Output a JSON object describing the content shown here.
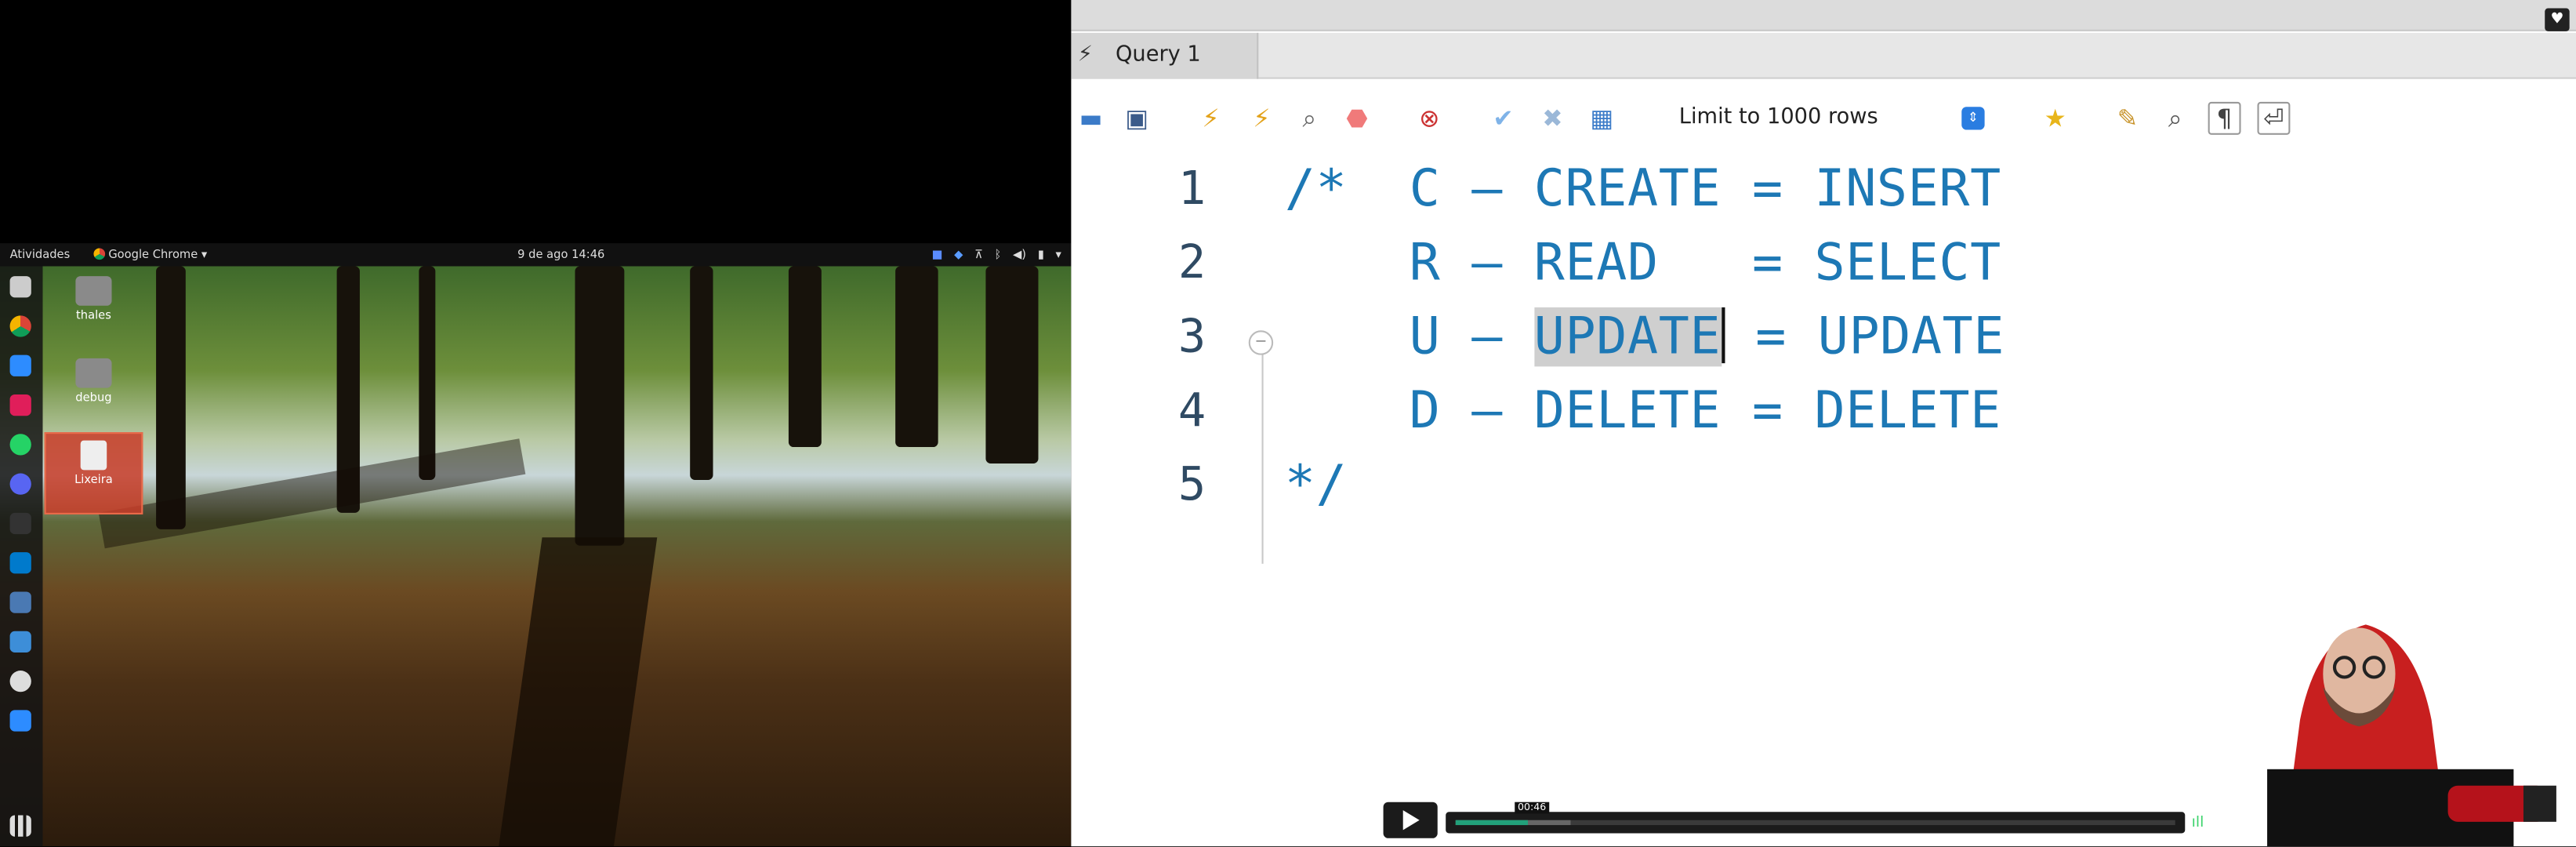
{
  "desktop": {
    "topbar": {
      "activities": "Atividades",
      "app_menu": "Google Chrome ▾",
      "clock": "9 de ago  14:46"
    },
    "items": [
      {
        "label": "thales"
      },
      {
        "label": "debug"
      },
      {
        "label": "Lixeira"
      }
    ],
    "dock_icons": [
      "files-icon",
      "chrome-icon",
      "zoom-icon",
      "slack-icon",
      "whatsapp-icon",
      "discord-icon",
      "terminal-icon",
      "vscode-icon",
      "workbench-icon",
      "screenshot-icon",
      "obs-icon",
      "zoom-meeting-icon",
      "app-grid-icon"
    ]
  },
  "workbench": {
    "tab": {
      "label": "Query 1"
    },
    "toolbar": {
      "limit": "Limit to 1000 rows",
      "icons": [
        "open-file-icon",
        "save-icon",
        "execute-icon",
        "execute-current-icon",
        "explain-icon",
        "stop-icon",
        "toggle-error-icon",
        "commit-icon",
        "rollback-icon",
        "autocommit-icon",
        "add-snippet-icon",
        "beautify-icon",
        "find-icon",
        "invisible-chars-icon",
        "wrap-icon"
      ]
    },
    "editor": {
      "lines": [
        {
          "num": "1",
          "pre": "/*  C – CREATE = INSERT",
          "sel": "",
          "post": ""
        },
        {
          "num": "2",
          "pre": "    R – READ   = SELECT",
          "sel": "",
          "post": ""
        },
        {
          "num": "3",
          "pre": "    U – ",
          "sel": "UPDATE",
          "post": " = UPDATE"
        },
        {
          "num": "4",
          "pre": "    D – DELETE = DELETE",
          "sel": "",
          "post": ""
        },
        {
          "num": "5",
          "pre": "*/",
          "sel": "",
          "post": ""
        }
      ]
    }
  },
  "player": {
    "time_tooltip": "00:46",
    "progress_fraction": 0.1,
    "buffer_fraction": 0.16
  },
  "colors": {
    "code": "#1d78b5",
    "line_numbers": "#2f4a63",
    "progress": "#22a07a"
  }
}
